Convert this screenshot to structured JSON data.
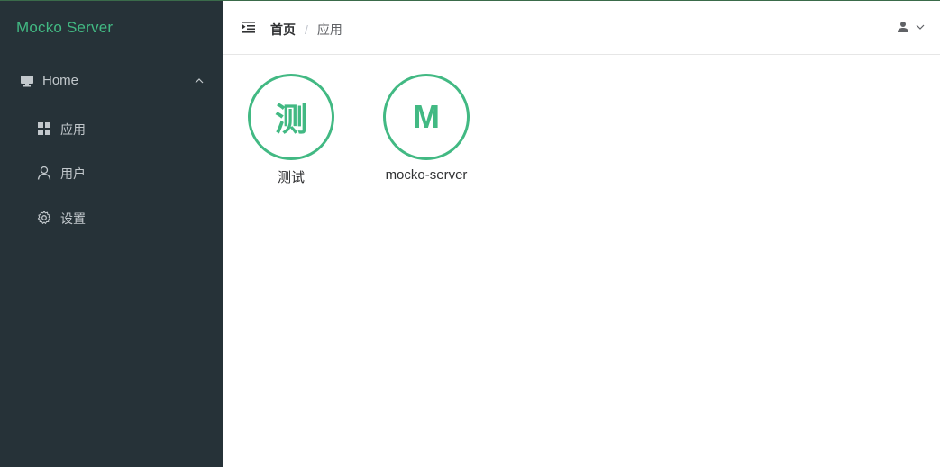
{
  "sidebar": {
    "brand": "Mocko Server",
    "group": {
      "label": "Home",
      "icon": "monitor-icon",
      "expanded": true
    },
    "items": [
      {
        "label": "应用",
        "icon": "grid-icon"
      },
      {
        "label": "用户",
        "icon": "user-icon"
      },
      {
        "label": "设置",
        "icon": "gear-icon"
      }
    ]
  },
  "header": {
    "breadcrumb": {
      "home": "首页",
      "separator": "/",
      "current": "应用"
    },
    "fold_icon": "menu-fold-icon",
    "user_icon": "user-avatar-icon"
  },
  "apps": [
    {
      "initial": "测",
      "name": "测试"
    },
    {
      "initial": "M",
      "name": "mocko-server"
    }
  ],
  "colors": {
    "accent": "#42b983",
    "sidebar_bg": "#263238",
    "sidebar_text": "#c2c8cc"
  }
}
